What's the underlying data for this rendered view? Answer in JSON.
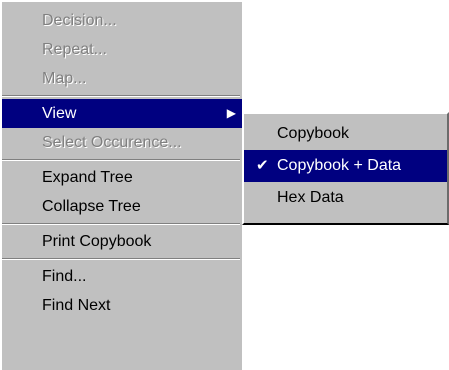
{
  "main_menu": {
    "decision": "Decision...",
    "repeat": "Repeat...",
    "map": "Map...",
    "view": "View",
    "select_occurence": "Select Occurence...",
    "expand_tree": "Expand Tree",
    "collapse_tree": "Collapse Tree",
    "print_copybook": "Print Copybook",
    "find": "Find...",
    "find_next": "Find Next"
  },
  "view_submenu": {
    "copybook": "Copybook",
    "copybook_data": "Copybook + Data",
    "hex_data": "Hex Data",
    "checked_item": "Copybook + Data"
  },
  "icons": {
    "submenu_arrow": "submenu-arrow-icon",
    "checkmark": "checkmark-icon"
  },
  "colors": {
    "menu_background": "#c0c0c0",
    "highlight": "#000080",
    "disabled_text": "#808080"
  }
}
